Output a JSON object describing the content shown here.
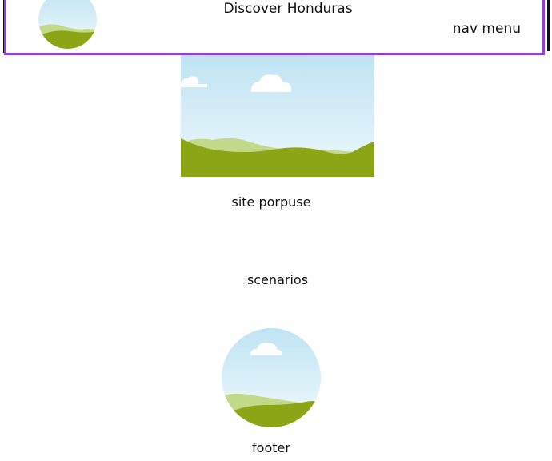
{
  "header": {
    "title": "Discover Honduras",
    "nav_label": "nav menu",
    "logo_icon": "landscape-placeholder-icon",
    "border_color": "#8c44d8"
  },
  "main": {
    "hero_image_icon": "landscape-placeholder-icon",
    "purpose_text": "site porpuse",
    "scenarios_text": "scenarios",
    "round_image_icon": "landscape-placeholder-icon"
  },
  "footer": {
    "text": "footer"
  },
  "colors": {
    "sky_top": "#bfe3f3",
    "sky_bottom": "#eef8fc",
    "hill_light": "#c3d98a",
    "hill_dark": "#8ba517"
  }
}
